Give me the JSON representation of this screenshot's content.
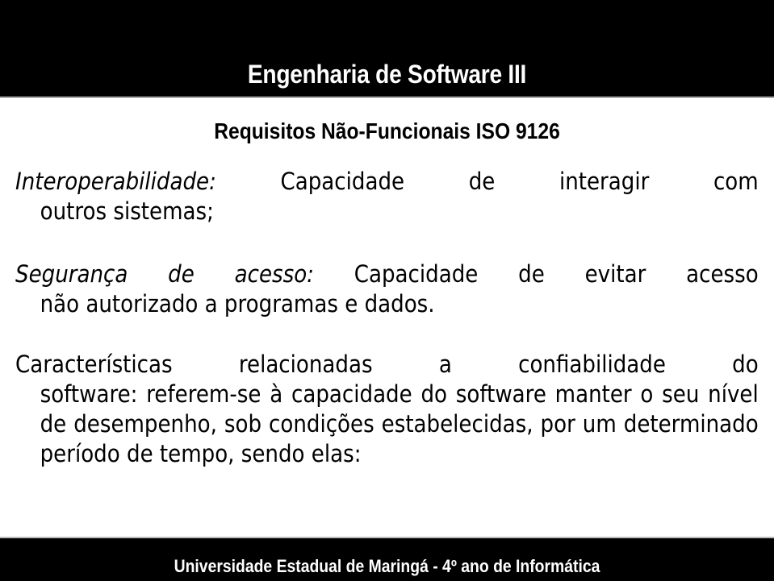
{
  "header": {
    "title": "Engenharia de Software III"
  },
  "slide": {
    "subtitle": "Requisitos Não-Funcionais ISO 9126",
    "paragraphs": [
      {
        "term": "Interoperabilidade:",
        "first_line_rest": " Capacidade de interagir com",
        "continuation": "outros sistemas;"
      },
      {
        "term": "Segurança de acesso:",
        "first_line_rest": " Capacidade de evitar acesso",
        "continuation": "não autorizado a programas e dados."
      },
      {
        "first_line": "Características relacionadas a confiabilidade do",
        "continuation": "software: referem-se à capacidade do software manter o seu nível de desempenho, sob condições estabelecidas, por um determinado período de tempo, sendo elas:"
      }
    ]
  },
  "footer": {
    "text": "Universidade Estadual de Maringá - 4º ano de Informática"
  }
}
